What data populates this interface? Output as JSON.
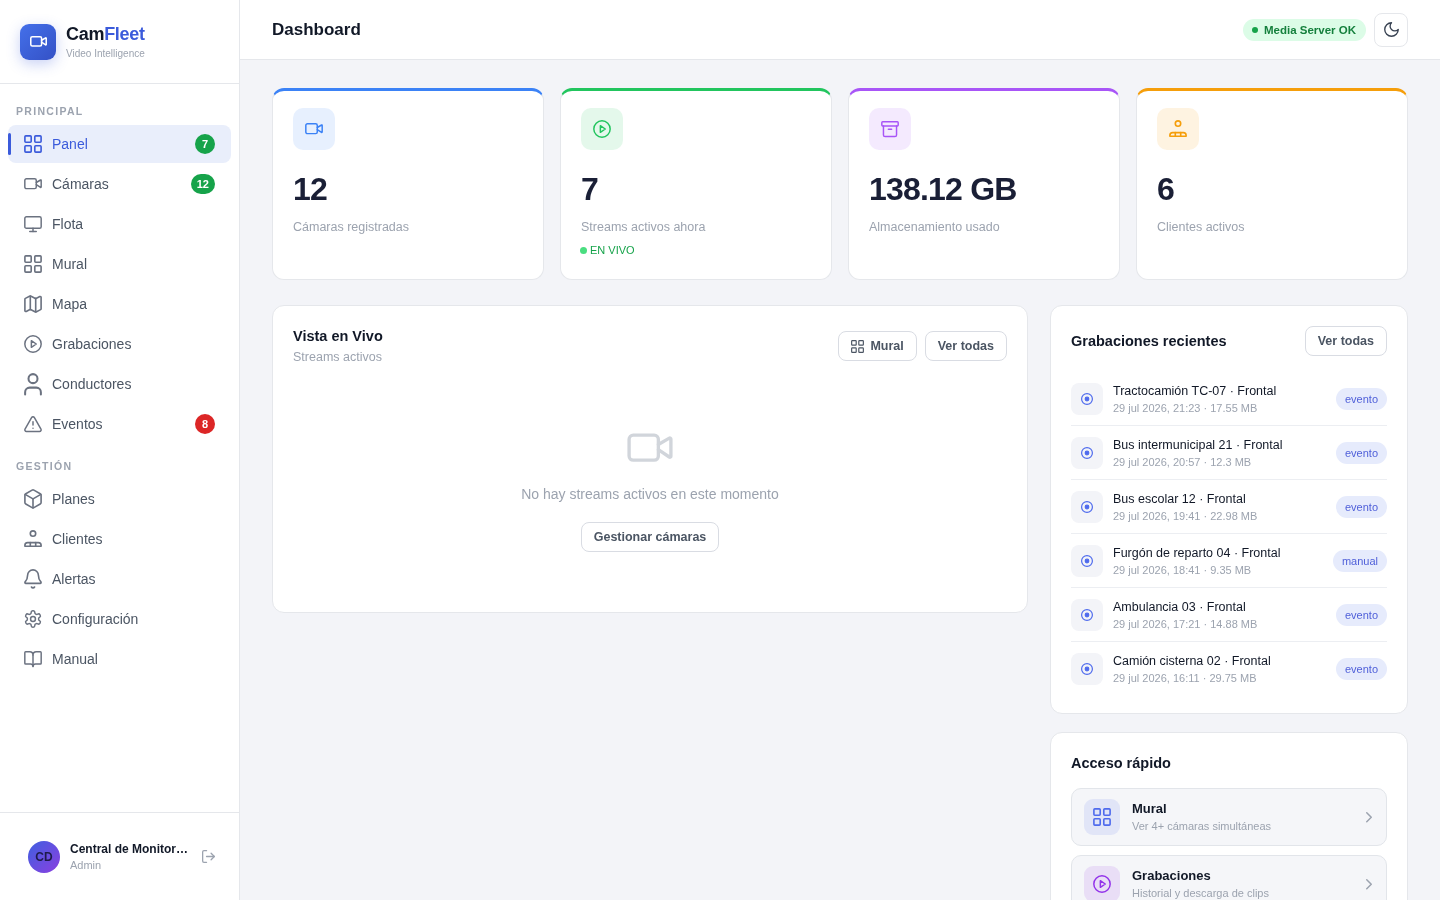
{
  "sidebar": {
    "brand": {
      "name": "Cam",
      "name_highlight": "Fleet",
      "tagline": "Video Intelligence"
    },
    "sections": [
      {
        "title": "PRINCIPAL",
        "items": [
          {
            "label": "Panel",
            "selected": true,
            "badge": {
              "text": "7",
              "color": "#16a34a"
            }
          },
          {
            "label": "Cámaras",
            "selected": false,
            "badge": {
              "text": "12",
              "color": "#16a34a"
            }
          },
          {
            "label": "Flota",
            "selected": false
          },
          {
            "label": "Mural",
            "selected": false
          },
          {
            "label": "Mapa",
            "selected": false
          },
          {
            "label": "Grabaciones",
            "selected": false
          },
          {
            "label": "Conductores",
            "selected": false
          },
          {
            "label": "Eventos",
            "selected": false,
            "badge": {
              "text": "8",
              "color": "#dc2626"
            }
          }
        ]
      },
      {
        "title": "GESTIÓN",
        "items": [
          {
            "label": "Planes",
            "selected": false
          },
          {
            "label": "Clientes",
            "selected": false
          },
          {
            "label": "Alertas",
            "selected": false
          },
          {
            "label": "Configuración",
            "selected": false
          },
          {
            "label": "Manual",
            "selected": false
          }
        ]
      }
    ],
    "user": {
      "initials": "CD",
      "name": "Central de Monitor…",
      "role": "Admin"
    }
  },
  "header": {
    "title": "Dashboard",
    "server_status": {
      "label": "Media Server OK",
      "ok": true
    }
  },
  "stats": [
    {
      "value": "12",
      "label": "Cámaras registradas",
      "color": "#3b82f6"
    },
    {
      "value": "7",
      "label": "Streams activos ahora",
      "color": "#22c55e",
      "live_label": "EN VIVO"
    },
    {
      "value": "138.12 GB",
      "label": "Almacenamiento usado",
      "color": "#a855f7"
    },
    {
      "value": "6",
      "label": "Clientes activos",
      "color": "#f59e0b"
    }
  ],
  "live_view": {
    "title": "Vista en Vivo",
    "subtitle": "Streams activos",
    "buttons": [
      "Mural",
      "Ver todas"
    ],
    "empty_message": "No hay streams activos en este momento",
    "empty_action": "Gestionar cámaras"
  },
  "recent_recordings": {
    "title": "Grabaciones recientes",
    "action": "Ver todas",
    "items": [
      {
        "title": "Tractocamión TC-07 · Frontal",
        "meta": "29 jul 2026, 21:23 · 17.55 MB",
        "tag": "evento"
      },
      {
        "title": "Bus intermunicipal 21 · Frontal",
        "meta": "29 jul 2026, 20:57 · 12.3 MB",
        "tag": "evento"
      },
      {
        "title": "Bus escolar 12 · Frontal",
        "meta": "29 jul 2026, 19:41 · 22.98 MB",
        "tag": "evento"
      },
      {
        "title": "Furgón de reparto 04 · Frontal",
        "meta": "29 jul 2026, 18:41 · 9.35 MB",
        "tag": "manual"
      },
      {
        "title": "Ambulancia 03 · Frontal",
        "meta": "29 jul 2026, 17:21 · 14.88 MB",
        "tag": "evento"
      },
      {
        "title": "Camión cisterna 02 · Frontal",
        "meta": "29 jul 2026, 16:11 · 29.75 MB",
        "tag": "evento"
      }
    ]
  },
  "quick_access": {
    "title": "Acceso rápido",
    "items": [
      {
        "title": "Mural",
        "subtitle": "Ver 4+ cámaras simultáneas",
        "color": "#4f6bed"
      },
      {
        "title": "Grabaciones",
        "subtitle": "Historial y descarga de clips",
        "color": "#9333ea"
      }
    ]
  }
}
